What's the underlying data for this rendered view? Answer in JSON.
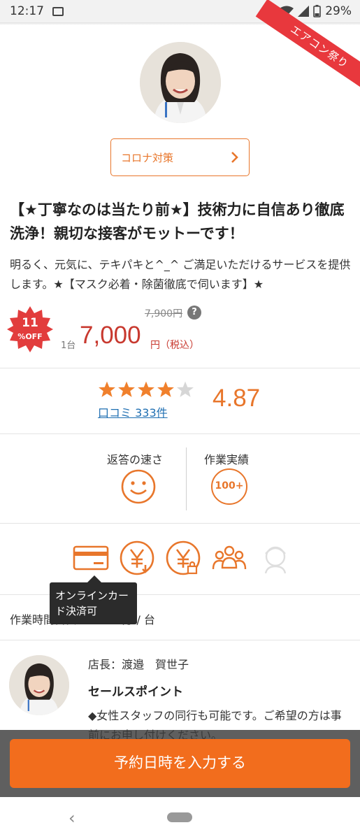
{
  "status_bar": {
    "time": "12:17",
    "battery": "29%"
  },
  "ribbon": {
    "label": "エアコン祭り"
  },
  "corona": {
    "label": "コロナ対策"
  },
  "title": "【★丁寧なのは当たり前★】技術力に自信あり徹底洗浄！親切な接客がモットーです！",
  "description": "明るく、元気に、テキパキと^_^ ご満足いただけるサービスを提供します。★【マスク必着・除菌徹底で伺います】★",
  "pricing": {
    "discount_value": "11",
    "discount_label": "%OFF",
    "old_price": "7,900円",
    "help_icon": "?",
    "unit": "1台",
    "price": "7,000",
    "price_suffix": "円（税込）"
  },
  "rating": {
    "stars": 4,
    "stars_max": 5,
    "review_label": "口コミ 333件",
    "score": "4.87",
    "star_color": "#f0802c",
    "star_empty_color": "#d6d6d6"
  },
  "metrics": {
    "reply_label": "返答の速さ",
    "reply_icon": "smile-face-icon",
    "results_label": "作業実績",
    "results_badge": "100+"
  },
  "payment": {
    "icons": [
      "credit-card-icon",
      "yen-download-icon",
      "yen-lock-icon",
      "group-icon",
      "staff-icon"
    ],
    "tooltip": "オンラインカード決済可"
  },
  "worktime": {
    "label": "作業時間目安",
    "value": "60分 / 台"
  },
  "staff": {
    "owner": "店長：渡邉　賀世子",
    "sales_heading": "セールスポイント",
    "sales_text": "◆女性スタッフの同行も可能です。ご希望の方は事前にお申し付けください。"
  },
  "cta": {
    "label": "予約日時を入力する"
  },
  "colors": {
    "accent": "#f26d1d",
    "price_red": "#c8392f",
    "ribbon": "#e8383d",
    "link": "#1f6fb2"
  }
}
